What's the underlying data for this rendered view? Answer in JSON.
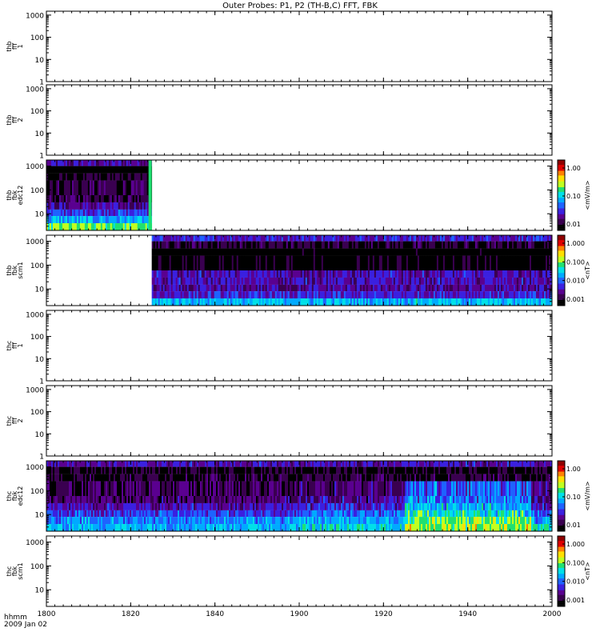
{
  "title": "Outer Probes: P1, P2 (TH-B,C) FFT, FBK",
  "x_axis": {
    "range": [
      "1800",
      "2000"
    ],
    "ticks": [
      "1800",
      "1820",
      "1840",
      "1900",
      "1920",
      "1940",
      "2000"
    ],
    "label_line1": "hhmm",
    "label_line2": "2009 Jan 02"
  },
  "colors": {
    "spectrogram_scale": [
      "#000000",
      "#3a0050",
      "#5a0090",
      "#3a20e0",
      "#1e63ff",
      "#00aaff",
      "#00e0e8",
      "#20e070",
      "#c0ff20",
      "#ffe000",
      "#ff8000",
      "#e00000",
      "#900000"
    ]
  },
  "chart_data": [
    {
      "type": "heatmap",
      "panel": "thb-fff-1",
      "ylabel": [
        "thb",
        "fff",
        "1"
      ],
      "yticks": [
        "1",
        "10",
        "100",
        "1000"
      ],
      "ylim": [
        1,
        1500
      ],
      "log_y": true,
      "data": "none shown"
    },
    {
      "type": "heatmap",
      "panel": "thb-fff-2",
      "ylabel": [
        "thb",
        "fff",
        "2"
      ],
      "yticks": [
        "1",
        "10",
        "100",
        "1000"
      ],
      "ylim": [
        1,
        1500
      ],
      "log_y": true,
      "data": "none shown"
    },
    {
      "type": "heatmap",
      "panel": "thb-fbk-edc12",
      "ylabel": [
        "thb",
        "fbk",
        "edc12"
      ],
      "yticks": [
        "10",
        "100",
        "1000"
      ],
      "ylim": [
        2,
        1800
      ],
      "log_y": true,
      "coverage": [
        "1800",
        "1825"
      ],
      "colorbar": {
        "label": "<mV/m>",
        "ticks": [
          "1.00",
          "0.10",
          "0.01"
        ]
      },
      "bands": [
        {
          "f_low": 1000,
          "f_high": 1800,
          "level": 0.2
        },
        {
          "f_low": 500,
          "f_high": 1000,
          "level": 0.0
        },
        {
          "f_low": 250,
          "f_high": 500,
          "level": 0.05
        },
        {
          "f_low": 60,
          "f_high": 250,
          "level": 0.1
        },
        {
          "f_low": 30,
          "f_high": 60,
          "level": 0.12
        },
        {
          "f_low": 15,
          "f_high": 30,
          "level": 0.18
        },
        {
          "f_low": 8,
          "f_high": 15,
          "level": 0.3
        },
        {
          "f_low": 4,
          "f_high": 8,
          "level": 0.42
        },
        {
          "f_low": 2,
          "f_high": 4,
          "level": 0.6
        }
      ]
    },
    {
      "type": "heatmap",
      "panel": "thb-fbk-scm1",
      "ylabel": [
        "thb",
        "fbk",
        "scm1"
      ],
      "yticks": [
        "10",
        "100",
        "1000"
      ],
      "ylim": [
        2,
        1800
      ],
      "log_y": true,
      "coverage": [
        "1825",
        "2000"
      ],
      "colorbar": {
        "label": "<nT>",
        "ticks": [
          "1.000",
          "0.100",
          "0.010",
          "0.001"
        ]
      },
      "bands": [
        {
          "f_low": 1000,
          "f_high": 1800,
          "level": 0.25
        },
        {
          "f_low": 500,
          "f_high": 1000,
          "level": 0.08
        },
        {
          "f_low": 250,
          "f_high": 500,
          "level": 0.0
        },
        {
          "f_low": 60,
          "f_high": 250,
          "level": 0.02
        },
        {
          "f_low": 30,
          "f_high": 60,
          "level": 0.22
        },
        {
          "f_low": 15,
          "f_high": 30,
          "level": 0.22
        },
        {
          "f_low": 8,
          "f_high": 15,
          "level": 0.18
        },
        {
          "f_low": 4,
          "f_high": 8,
          "level": 0.25
        },
        {
          "f_low": 2,
          "f_high": 4,
          "level": 0.45
        }
      ]
    },
    {
      "type": "heatmap",
      "panel": "thc-fff-1",
      "ylabel": [
        "thc",
        "fff",
        "1"
      ],
      "yticks": [
        "1",
        "10",
        "100",
        "1000"
      ],
      "ylim": [
        1,
        1500
      ],
      "log_y": true,
      "data": "none shown"
    },
    {
      "type": "heatmap",
      "panel": "thc-fff-2",
      "ylabel": [
        "thc",
        "fff",
        "2"
      ],
      "yticks": [
        "1",
        "10",
        "100",
        "1000"
      ],
      "ylim": [
        1,
        1500
      ],
      "log_y": true,
      "data": "none shown"
    },
    {
      "type": "heatmap",
      "panel": "thc-fbk-edc12",
      "ylabel": [
        "thc",
        "fbk",
        "edc12"
      ],
      "yticks": [
        "10",
        "100",
        "1000"
      ],
      "ylim": [
        2,
        1800
      ],
      "log_y": true,
      "coverage": [
        "1800",
        "2000"
      ],
      "colorbar": {
        "label": "<mV/m>",
        "ticks": [
          "1.00",
          "0.10",
          "0.01"
        ]
      },
      "bands": [
        {
          "f_low": 1000,
          "f_high": 1800,
          "level": 0.22
        },
        {
          "f_low": 500,
          "f_high": 1000,
          "level": 0.05
        },
        {
          "f_low": 250,
          "f_high": 500,
          "level": 0.08
        },
        {
          "f_low": 60,
          "f_high": 250,
          "level": 0.12
        },
        {
          "f_low": 30,
          "f_high": 60,
          "level": 0.15
        },
        {
          "f_low": 15,
          "f_high": 30,
          "level": 0.22
        },
        {
          "f_low": 8,
          "f_high": 15,
          "level": 0.3
        },
        {
          "f_low": 4,
          "f_high": 8,
          "level": 0.38
        },
        {
          "f_low": 2,
          "f_high": 4,
          "level": 0.45
        }
      ],
      "enhancement": {
        "from": "1925",
        "to": "1955",
        "level_boost": 0.25
      }
    },
    {
      "type": "heatmap",
      "panel": "thc-fbk-scm1",
      "ylabel": [
        "thc",
        "fbk",
        "scm1"
      ],
      "yticks": [
        "10",
        "100",
        "1000"
      ],
      "ylim": [
        2,
        1800
      ],
      "log_y": true,
      "colorbar": {
        "label": "<nT>",
        "ticks": [
          "1.000",
          "0.100",
          "0.010",
          "0.001"
        ]
      },
      "data": "none shown"
    }
  ]
}
